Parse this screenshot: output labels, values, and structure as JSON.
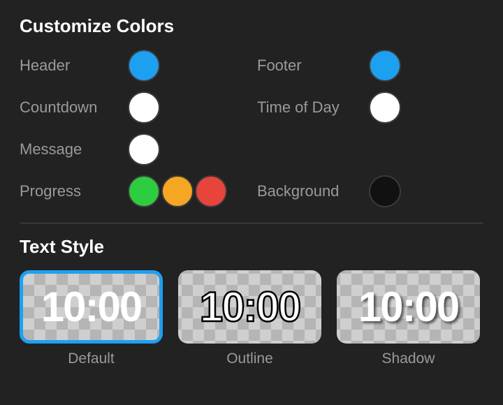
{
  "customize": {
    "title": "Customize Colors",
    "header_label": "Header",
    "footer_label": "Footer",
    "countdown_label": "Countdown",
    "timeofday_label": "Time of Day",
    "message_label": "Message",
    "progress_label": "Progress",
    "background_label": "Background",
    "header_color": "#1ea0f1",
    "footer_color": "#1ea0f1",
    "countdown_color": "#ffffff",
    "timeofday_color": "#ffffff",
    "message_color": "#ffffff",
    "progress_color_1": "#2ecc40",
    "progress_color_2": "#f5a623",
    "progress_color_3": "#e7443b",
    "background_color": "#111111"
  },
  "text_style": {
    "title": "Text Style",
    "preview_text": "10:00",
    "default_label": "Default",
    "outline_label": "Outline",
    "shadow_label": "Shadow",
    "selected": "default"
  }
}
